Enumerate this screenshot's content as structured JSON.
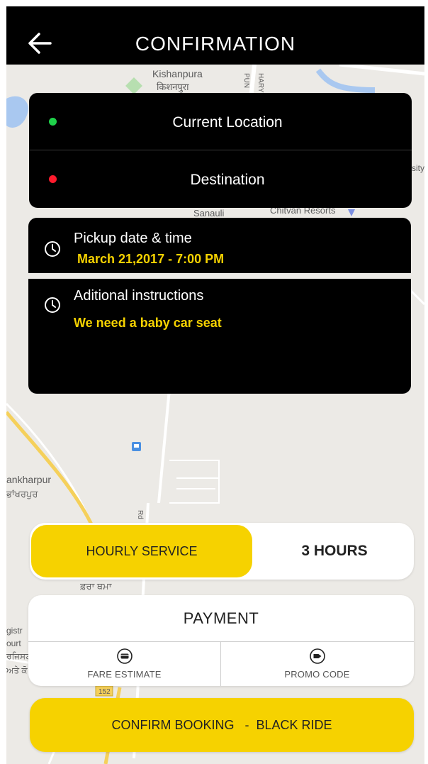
{
  "header": {
    "title": "CONFIRMATION",
    "back_icon": "arrow-left-icon"
  },
  "map": {
    "labels": [
      "Kishanpura",
      "किशनपुरा",
      "HARY",
      "PUN",
      "Sanauli",
      "Chitvan Resorts",
      "sity",
      "ankharpur",
      "ਭਾਂਖਰਪੁਰ",
      "Rd",
      "ਫ਼ਰਾ ਥਮਾ",
      "gistr",
      "ourt",
      "ਰਜਿਸਟ",
      "ਅਤੇ ਕੋ",
      "152"
    ]
  },
  "locations": {
    "pickup_label": "Current Location",
    "pickup_dot_color": "#1fd14a",
    "destination_label": "Destination",
    "destination_dot_color": "#ff1b2d"
  },
  "pickup": {
    "label": "Pickup date & time",
    "value": "March 21,2017  - 7:00 PM",
    "icon": "clock-icon"
  },
  "instructions": {
    "label": "Aditional instructions",
    "value": "We need a baby car seat",
    "icon": "clock-icon"
  },
  "service": {
    "type_label": "HOURLY SERVICE",
    "duration": "3 HOURS"
  },
  "payment": {
    "title": "PAYMENT",
    "options": [
      {
        "label": "FARE ESTIMATE",
        "icon": "credit-card-icon"
      },
      {
        "label": "PROMO CODE",
        "icon": "tag-icon"
      }
    ]
  },
  "confirm": {
    "label": "CONFIRM BOOKING   -  BLACK RIDE"
  },
  "colors": {
    "accent": "#f6d200",
    "dark": "#000000",
    "map_bg": "#eceae6"
  }
}
